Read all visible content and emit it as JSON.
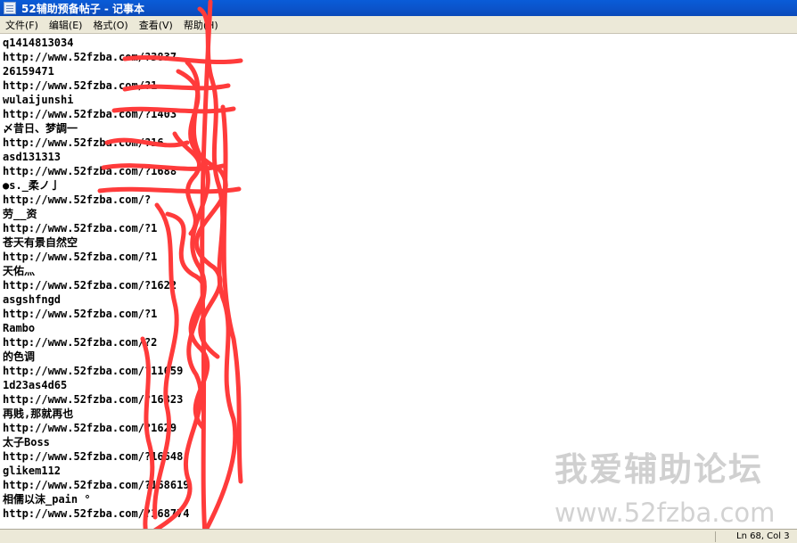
{
  "window": {
    "title": "52辅助预备帖子 - 记事本"
  },
  "menu": [
    {
      "label": "文件(F)"
    },
    {
      "label": "编辑(E)"
    },
    {
      "label": "格式(O)"
    },
    {
      "label": "查看(V)"
    },
    {
      "label": "帮助(H)"
    }
  ],
  "document": {
    "lines": [
      "q1414813034",
      "http://www.52fzba.com/?3837",
      "26159471",
      "http://www.52fzba.com/?1",
      "wulaijunshi",
      "http://www.52fzba.com/?1403",
      "〆昔日、梦調一",
      "http://www.52fzba.com/?16",
      "asd131313",
      "http://www.52fzba.com/?1688",
      "●s._柔ノ亅",
      "http://www.52fzba.com/?",
      "劳__资",
      "http://www.52fzba.com/?1",
      "苍天有景自然空",
      "http://www.52fzba.com/?1",
      "天佑灬",
      "http://www.52fzba.com/?1622",
      "asgshfngd",
      "http://www.52fzba.com/?1",
      "Rambo",
      "http://www.52fzba.com/?2",
      "的色调",
      "http://www.52fzba.com/?11659",
      "1d23as4d65",
      "http://www.52fzba.com/?16823",
      "再贱,那就再也",
      "http://www.52fzba.com/?1629",
      "太子Boss",
      "http://www.52fzba.com/?16648",
      "glikem112",
      "http://www.52fzba.com/?168619",
      "相儒以沫_pain °",
      "http://www.52fzba.com/?168774"
    ]
  },
  "statusbar": {
    "position": "Ln 68, Col 3"
  },
  "watermark": {
    "line1": "我爱辅助论坛",
    "line2": "www.52fzba.com"
  },
  "colors": {
    "titlebar": "#0b52c8",
    "menubar": "#ece9d8",
    "scribble": "#ff3b3b",
    "watermark": "#c8c8c8"
  }
}
